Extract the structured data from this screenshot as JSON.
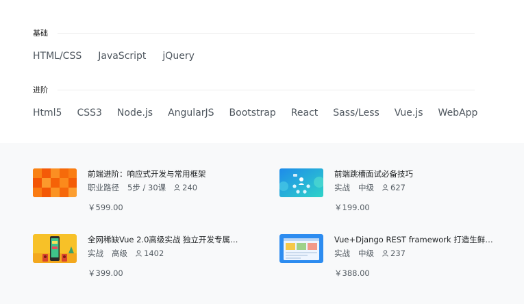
{
  "basic": {
    "title": "基础",
    "tags": [
      "HTML/CSS",
      "JavaScript",
      "jQuery"
    ]
  },
  "advanced": {
    "title": "进阶",
    "tags": [
      "Html5",
      "CSS3",
      "Node.js",
      "AngularJS",
      "Bootstrap",
      "React",
      "Sass/Less",
      "Vue.js",
      "WebApp"
    ]
  },
  "courses": [
    {
      "title": "前端进阶：响应式开发与常用框架",
      "tag1": "职业路径",
      "tag2": "5步 / 30课",
      "users": "240",
      "price": "￥599.00",
      "thumb_icon": "orange-mosaic-thumbnail"
    },
    {
      "title": "前端跳槽面试必备技巧",
      "tag1": "实战",
      "tag2": "中级",
      "users": "627",
      "price": "￥199.00",
      "thumb_icon": "interview-people-thumbnail"
    },
    {
      "title": "全网稀缺Vue 2.0高级实战 独立开发专属…",
      "tag1": "实战",
      "tag2": "高级",
      "users": "1402",
      "price": "￥399.00",
      "thumb_icon": "music-app-thumbnail"
    },
    {
      "title": "Vue+Django REST framework 打造生鲜…",
      "tag1": "实战",
      "tag2": "中级",
      "users": "237",
      "price": "￥388.00",
      "thumb_icon": "shop-webpage-thumbnail"
    }
  ]
}
